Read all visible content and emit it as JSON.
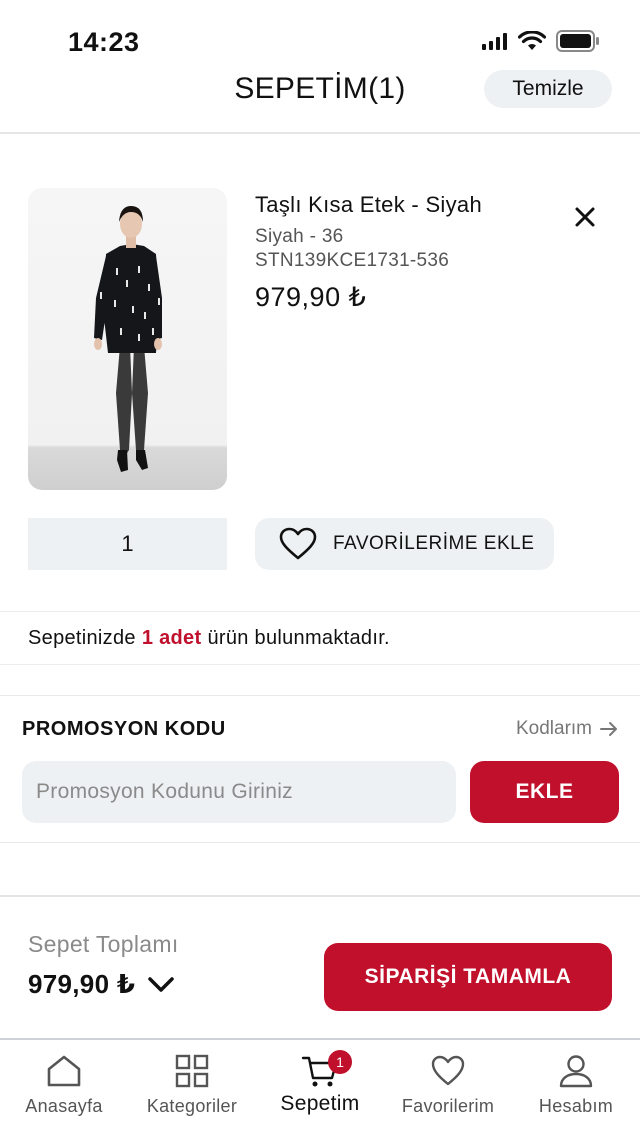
{
  "status": {
    "time": "14:23"
  },
  "header": {
    "title": "SEPETİM(1)",
    "clear_label": "Temizle"
  },
  "product": {
    "name": "Taşlı Kısa Etek - Siyah",
    "variant": "Siyah - 36",
    "sku": "STN139KCE1731-536",
    "price": "979,90 ₺",
    "quantity": "1",
    "favorite_label": "FAVORİLERİME EKLE"
  },
  "info": {
    "prefix": "Sepetinizde",
    "count": "1 adet",
    "suffix": "ürün bulunmaktadır."
  },
  "promo": {
    "title": "PROMOSYON KODU",
    "link_label": "Kodlarım",
    "placeholder": "Promosyon Kodunu Giriniz",
    "button_label": "EKLE"
  },
  "summary": {
    "label": "Sepet Toplamı",
    "total": "979,90 ₺",
    "checkout_label": "SİPARİŞİ TAMAMLA"
  },
  "tabs": [
    {
      "label": "Anasayfa",
      "icon": "home-icon"
    },
    {
      "label": "Kategoriler",
      "icon": "grid-icon"
    },
    {
      "label": "Sepetim",
      "icon": "cart-icon",
      "badge": "1"
    },
    {
      "label": "Favorilerim",
      "icon": "heart-icon"
    },
    {
      "label": "Hesabım",
      "icon": "user-icon"
    }
  ],
  "colors": {
    "accent": "#c0102c",
    "surface": "#eef1f3"
  }
}
